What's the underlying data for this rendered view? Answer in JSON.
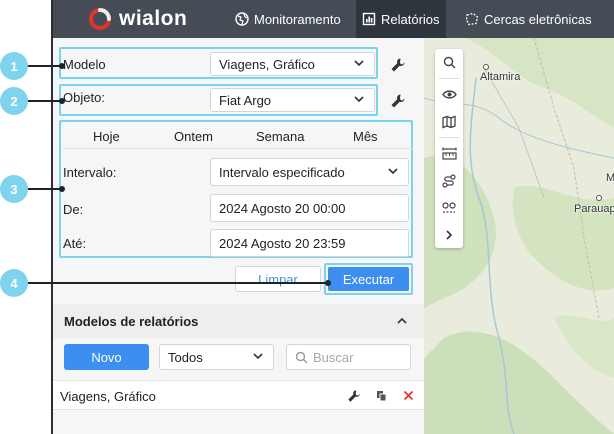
{
  "app": {
    "logo_text": "wialon"
  },
  "nav": [
    {
      "label": "Monitoramento",
      "icon": "globe-icon"
    },
    {
      "label": "Relatórios",
      "icon": "report-icon",
      "active": true
    },
    {
      "label": "Cercas eletrônicas",
      "icon": "geofence-icon"
    }
  ],
  "form": {
    "template_label": "Modelo",
    "template_value": "Viagens, Gráfico",
    "object_label": "Objeto:",
    "object_value": "Fiat Argo",
    "quick_ranges": [
      "Hoje",
      "Ontem",
      "Semana",
      "Mês"
    ],
    "interval_label": "Intervalo:",
    "interval_value": "Intervalo especificado",
    "from_label": "De:",
    "from_value": "2024 Agosto 20 00:00",
    "to_label": "Até:",
    "to_value": "2024 Agosto 20 23:59",
    "clear_label": "Limpar",
    "execute_label": "Executar"
  },
  "templates": {
    "title": "Modelos de relatórios",
    "new_label": "Novo",
    "filter_value": "Todos",
    "search_placeholder": "Buscar",
    "items": [
      {
        "name": "Viagens, Gráfico"
      }
    ]
  },
  "map": {
    "cities": [
      "Altamira",
      "Parauapeb",
      "M"
    ],
    "tools": [
      "search-icon",
      "eye-icon",
      "map-icon",
      "ruler-icon",
      "route-icon",
      "trips-icon",
      "chevron-right-icon"
    ]
  },
  "callouts": [
    "1",
    "2",
    "3",
    "4"
  ],
  "colors": {
    "header": "#454c56",
    "accent": "#3c8ef0",
    "highlight": "#79d3ec",
    "callout": "#7ed3ed",
    "delete": "#e53935",
    "logo_red": "#e4312d"
  }
}
